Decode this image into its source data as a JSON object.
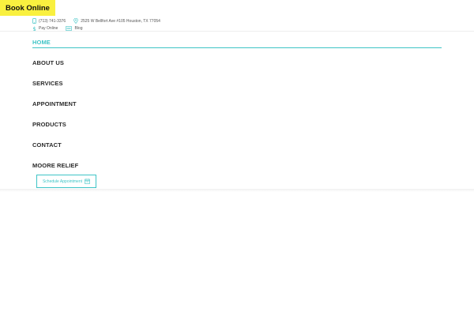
{
  "book_online": {
    "label": "Book Online",
    "color": "#f9f03f"
  },
  "topbar": {
    "phone": {
      "icon": "phone-icon",
      "text": "(713) 741-3376"
    },
    "address": {
      "icon": "map-pin-icon",
      "text": "2525 W Bellfort Ave #105 Houston, TX 77054"
    },
    "pay": {
      "icon": "dollar-icon",
      "text": "Pay Online"
    },
    "blog": {
      "icon": "blog-icon",
      "text": "Blog"
    }
  },
  "nav": {
    "accent_color": "#3ec4c6",
    "items": [
      {
        "label": "HOME",
        "active": true
      },
      {
        "label": "ABOUT US",
        "active": false
      },
      {
        "label": "SERVICES",
        "active": false
      },
      {
        "label": "APPOINTMENT",
        "active": false
      },
      {
        "label": "PRODUCTS",
        "active": false
      },
      {
        "label": "CONTACT",
        "active": false
      },
      {
        "label": "MOORE RELIEF",
        "active": false
      }
    ]
  },
  "schedule": {
    "label": "Schedule Appointment",
    "icon": "calendar-icon"
  }
}
